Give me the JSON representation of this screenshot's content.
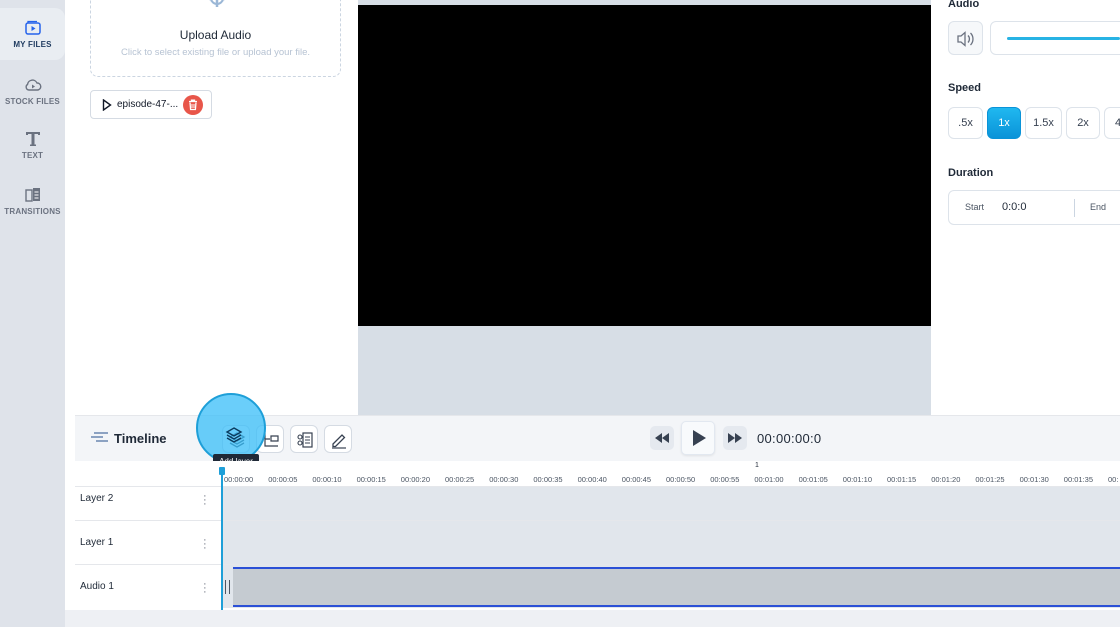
{
  "sidebar": {
    "items": [
      {
        "label": "MY FILES",
        "icon": "video-file-icon",
        "active": true
      },
      {
        "label": "STOCK FILES",
        "icon": "cloud-play-icon",
        "active": false
      },
      {
        "label": "TEXT",
        "icon": "text-t-icon",
        "active": false
      },
      {
        "label": "TRANSITIONS",
        "icon": "transitions-icon",
        "active": false
      }
    ]
  },
  "files": {
    "upload_title": "Upload Audio",
    "upload_subtitle": "Click to select existing file or upload your file.",
    "items": [
      {
        "name": "episode-47-..."
      }
    ]
  },
  "properties": {
    "audio_label": "Audio",
    "speed_label": "Speed",
    "speed_options": [
      ".5x",
      "1x",
      "1.5x",
      "2x",
      "4"
    ],
    "speed_selected": "1x",
    "duration_label": "Duration",
    "duration_start_label": "Start",
    "duration_start_value": "0:0:0",
    "duration_end_label": "End",
    "volume_level": 1.0
  },
  "timeline": {
    "title": "Timeline",
    "tooltip": "Add layer",
    "time_display": "00:00:00:0",
    "ruler_marker": "1",
    "ruler_labels": [
      "00:00:00",
      "00:00:05",
      "00:00:10",
      "00:00:15",
      "00:00:20",
      "00:00:25",
      "00:00:30",
      "00:00:35",
      "00:00:40",
      "00:00:45",
      "00:00:50",
      "00:00:55",
      "00:01:00",
      "00:01:05",
      "00:01:10",
      "00:01:15",
      "00:01:20",
      "00:01:25",
      "00:01:30",
      "00:01:35",
      "00:"
    ],
    "layers": [
      {
        "name": "Layer 2"
      },
      {
        "name": "Layer 1"
      },
      {
        "name": "Audio 1"
      }
    ]
  },
  "colors": {
    "accent": "#0ea5e9",
    "delete": "#e8564a",
    "audio_clip_border": "#2b50d6"
  }
}
